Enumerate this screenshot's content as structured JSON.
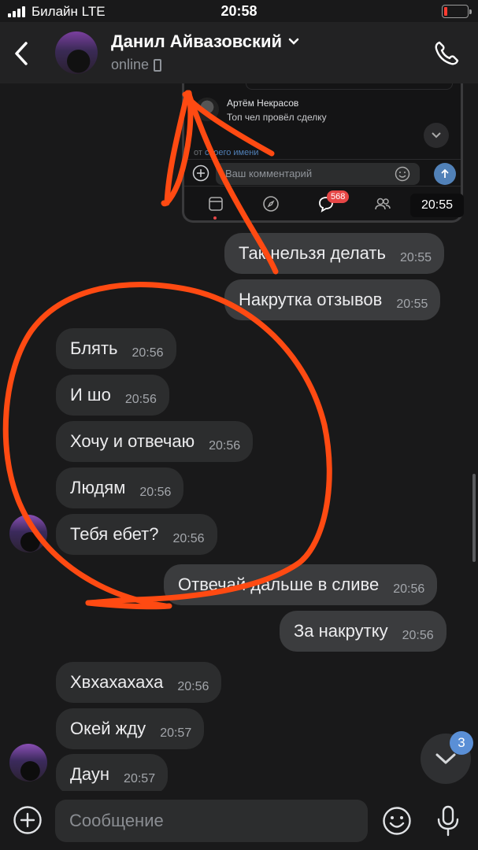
{
  "status_bar": {
    "carrier": "Билайн LTE",
    "time": "20:58",
    "battery_level": 0.15
  },
  "header": {
    "title": "Данил Айвазовский",
    "status": "online"
  },
  "embedded": {
    "commenter_name": "Артём Некрасов",
    "comment_text": "Топ чел провёл сделку",
    "hint_prefix": "от ",
    "hint_link": "своего имени",
    "input_placeholder": "Ваш комментарий",
    "messages_badge": "568",
    "time_box": "20:55"
  },
  "messages": [
    {
      "text": "Так нельзя делать",
      "time": "20:55",
      "dir": "out"
    },
    {
      "text": "Накрутка отзывов",
      "time": "20:55",
      "dir": "out"
    },
    {
      "text": "Блять",
      "time": "20:56",
      "dir": "in"
    },
    {
      "text": "И шо",
      "time": "20:56",
      "dir": "in"
    },
    {
      "text": "Хочу и отвечаю",
      "time": "20:56",
      "dir": "in"
    },
    {
      "text": "Людям",
      "time": "20:56",
      "dir": "in"
    },
    {
      "text": "Тебя ебет?",
      "time": "20:56",
      "dir": "in"
    },
    {
      "text": "Отвечай дальше в сливе",
      "time": "20:56",
      "dir": "out"
    },
    {
      "text": "За накрутку",
      "time": "20:56",
      "dir": "out"
    },
    {
      "text": "Хвхахахаха",
      "time": "20:56",
      "dir": "in"
    },
    {
      "text": "Окей жду",
      "time": "20:57",
      "dir": "in"
    },
    {
      "text": "Даун",
      "time": "20:57",
      "dir": "in"
    }
  ],
  "scroll_down_badge": "3",
  "composer": {
    "placeholder": "Сообщение"
  },
  "annotation_color": "#ff4a12"
}
